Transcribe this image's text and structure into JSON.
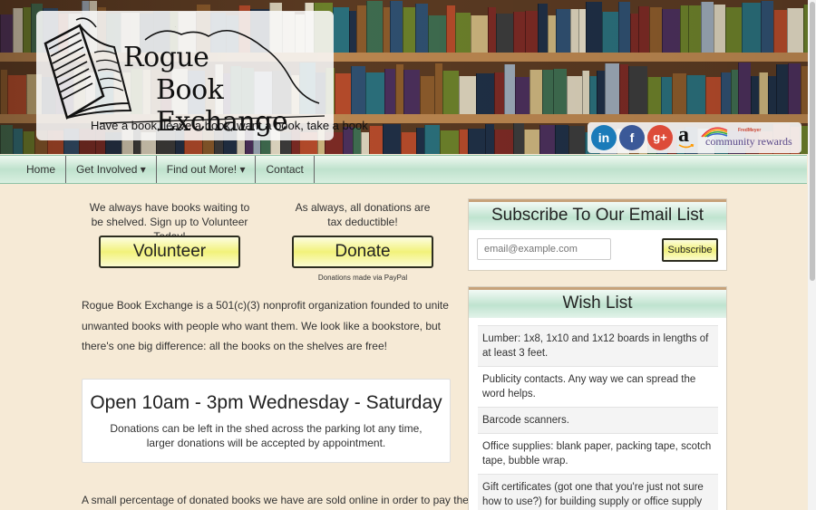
{
  "header": {
    "logo_title_line1": "Rogue",
    "logo_title_line2": "Book Exchange",
    "tagline": "Have a book, leave a book, want a book, take a book",
    "social": {
      "linkedin_glyph": "in",
      "facebook_glyph": "f",
      "googleplus_glyph": "g+",
      "amazon_glyph": "a",
      "fredmeyer_small": "FredMeyer",
      "community_rewards": "community rewards"
    }
  },
  "nav": {
    "items": [
      {
        "label": "Home"
      },
      {
        "label": "Get Involved ▾"
      },
      {
        "label": "Find out More! ▾"
      },
      {
        "label": "Contact"
      }
    ]
  },
  "main": {
    "volunteer_text": "We always have books waiting to be shelved. Sign up to Volunteer Today!",
    "volunteer_button": "Volunteer",
    "donate_text": "As always, all donations are tax deductible!",
    "donate_button": "Donate",
    "donate_note": "Donations made via PayPal",
    "intro": "Rogue Book Exchange is a 501(c)(3) nonprofit organization founded to unite unwanted books with people who want them. We look like a bookstore, but there's one big difference: all the books on the shelves are free!",
    "hours_title": "Open 10am - 3pm Wednesday - Saturday",
    "hours_note": "Donations can be left in the shed across the parking lot any time, larger donations will be accepted by appointment.",
    "bottom_text": "A small percentage of donated books we have are sold online in order to pay the bills."
  },
  "sidebar": {
    "email_title": "Subscribe To Our Email List",
    "email_placeholder": "email@example.com",
    "subscribe_label": "Subscribe",
    "wishlist_title": "Wish List",
    "wishlist_items": [
      "Lumber: 1x8, 1x10 and 1x12 boards in lengths of at least 3 feet.",
      "Publicity contacts. Any way we can spread the word helps.",
      "Barcode scanners.",
      "Office supplies: blank paper, packing tape, scotch tape, bubble wrap.",
      "Gift certificates (got one that you're just not sure how to use?) for building supply or office supply stores."
    ]
  },
  "colors": {
    "page_bg": "#f6ead6",
    "nav_green": "#bfe2cd",
    "button_yellow": "#f2f27a",
    "linkedin": "#1a7bb9",
    "facebook": "#3b5998",
    "googleplus": "#dd4b39"
  }
}
